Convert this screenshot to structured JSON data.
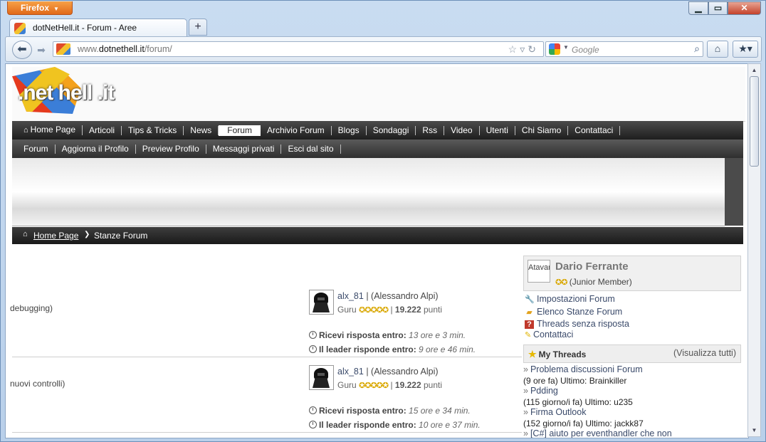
{
  "browser": {
    "app_button": "Firefox",
    "tab_title": "dotNetHell.it - Forum - Aree",
    "url_prefix": "www.",
    "url_domain": "dotnethell.it",
    "url_path": "/forum/",
    "search_placeholder": "Google",
    "favicon_text": "DNH"
  },
  "site": {
    "logo_text": ".net hell .it",
    "main_menu": [
      "Home Page",
      "Articoli",
      "Tips & Tricks",
      "News",
      "Forum",
      "Archivio Forum",
      "Blogs",
      "Sondaggi",
      "Rss",
      "Video",
      "Utenti",
      "Chi Siamo",
      "Contattaci"
    ],
    "active_menu": "Forum",
    "sub_menu": [
      "Forum",
      "Aggiorna il Profilo",
      "Preview Profilo",
      "Messaggi privati",
      "Esci dal sito"
    ],
    "breadcrumb": {
      "home": "Home Page",
      "current": "Stanze Forum"
    }
  },
  "forum_rows": [
    {
      "description": "debugging)",
      "user": "alx_81",
      "full_name": "(Alessandro Alpi)",
      "rank": "Guru",
      "points": "19.222",
      "points_suffix": "punti",
      "reply_label": "Ricevi risposta entro:",
      "reply_time": "13 ore e 3 min.",
      "leader_label": "Il leader risponde entro:",
      "leader_time": "9 ore e 46 min."
    },
    {
      "description": "nuovi controlli)",
      "user": "alx_81",
      "full_name": "(Alessandro Alpi)",
      "rank": "Guru",
      "points": "19.222",
      "points_suffix": "punti",
      "reply_label": "Ricevi risposta entro:",
      "reply_time": "15 ore e 34 min.",
      "leader_label": "Il leader risponde entro:",
      "leader_time": "10 ore e 37 min."
    }
  ],
  "sidebar": {
    "avatar_alt": "Atavar",
    "user_name": "Dario Ferrante",
    "user_level": "(Junior Member)",
    "links": [
      "Impostazioni Forum",
      "Elenco Stanze Forum",
      "Threads senza risposta",
      "Contattaci"
    ],
    "my_threads_title": "My Threads",
    "my_threads_view_all": "(Visualizza tutti)",
    "threads": [
      {
        "title": "Problema discussioni Forum",
        "meta": "(9 ore fa) Ultimo: Brainkiller"
      },
      {
        "title": "Pdding",
        "meta": "(115 giorno/i fa) Ultimo: u235"
      },
      {
        "title": "Firma Outlook",
        "meta": "(152 giorno/i fa) Ultimo: jackk87"
      },
      {
        "title": "[C#] aiuto per eventhandler che non",
        "meta": ""
      }
    ]
  },
  "colors": {
    "menu_dark": "#1e1e1e",
    "link": "#3a4a6a",
    "star": "#d9a700",
    "firefox_orange": "#e1691a"
  }
}
